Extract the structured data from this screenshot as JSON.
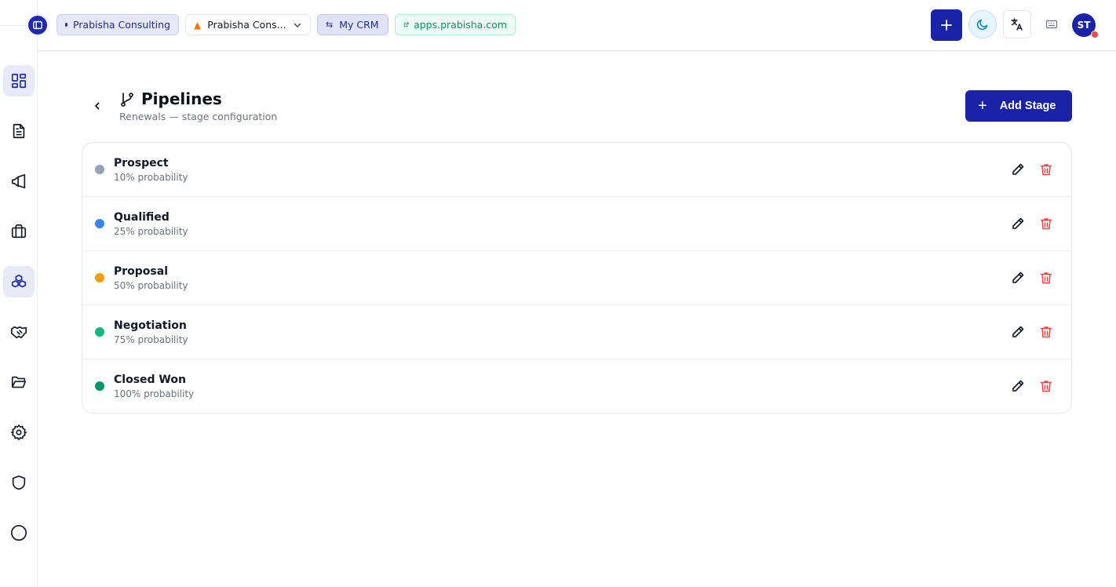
{
  "header": {
    "company_chip": "Prabisha Consulting",
    "org_select": "Prabisha Cons...",
    "crm_chip": "My CRM",
    "site_link": "apps.prabisha.com",
    "avatar_initials": "ST"
  },
  "sidebar": {
    "items": [
      {
        "icon": "dashboard-icon",
        "active": true
      },
      {
        "icon": "document-icon",
        "active": false
      },
      {
        "icon": "megaphone-icon",
        "active": false
      },
      {
        "icon": "briefcase-icon",
        "active": false
      },
      {
        "icon": "boxes-icon",
        "active": true
      },
      {
        "icon": "handshake-icon",
        "active": false
      },
      {
        "icon": "folder-icon",
        "active": false
      },
      {
        "icon": "gear-icon",
        "active": false
      },
      {
        "icon": "shield-icon",
        "active": false
      },
      {
        "icon": "circle-icon",
        "active": false
      }
    ]
  },
  "page": {
    "title": "Pipelines",
    "subtitle": "Renewals — stage configuration",
    "add_button": "Add Stage"
  },
  "stages": [
    {
      "name": "Prospect",
      "probability": "10% probability",
      "color": "#94a3b8"
    },
    {
      "name": "Qualified",
      "probability": "25% probability",
      "color": "#3b82f6"
    },
    {
      "name": "Proposal",
      "probability": "50% probability",
      "color": "#f59e0b"
    },
    {
      "name": "Negotiation",
      "probability": "75% probability",
      "color": "#10b981"
    },
    {
      "name": "Closed Won",
      "probability": "100% probability",
      "color": "#059669"
    }
  ],
  "colors": {
    "primary": "#1a22a8",
    "danger": "#ef4444"
  }
}
